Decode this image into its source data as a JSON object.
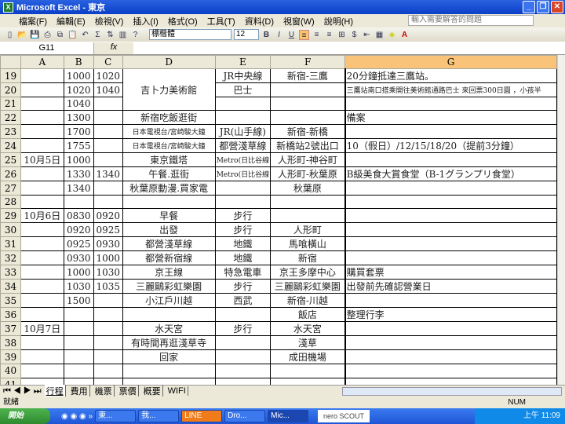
{
  "window": {
    "title": "Microsoft Excel - 東京"
  },
  "menu": [
    "檔案(F)",
    "編輯(E)",
    "檢視(V)",
    "插入(I)",
    "格式(O)",
    "工具(T)",
    "資料(D)",
    "視窗(W)",
    "說明(H)"
  ],
  "help_placeholder": "輸入需要解答的問題",
  "toolbar": {
    "font": "標楷體",
    "size": "12",
    "bold": "B",
    "italic": "I",
    "underline": "U",
    "currency": "$",
    "sum": "Σ"
  },
  "formula": {
    "cell": "G11",
    "fx": "fx",
    "value": ""
  },
  "columns": [
    "A",
    "B",
    "C",
    "D",
    "E",
    "F",
    "G"
  ],
  "rows": [
    {
      "n": "19",
      "c": [
        "",
        "1000",
        "1020",
        {
          "v": "吉卜力美術館",
          "rs": 3
        },
        "JR中央線",
        "新宿-三鷹",
        "20分鐘抵達三鷹站。"
      ]
    },
    {
      "n": "20",
      "c": [
        "",
        "1020",
        "1040",
        "巴士",
        "",
        "三鷹站南口搭乘開往美術館通路巴士 來回票300日圓 ，小孩半"
      ]
    },
    {
      "n": "21",
      "c": [
        "",
        "1040",
        "",
        "",
        "",
        ""
      ]
    },
    {
      "n": "22",
      "c": [
        "",
        "1300",
        "",
        "新宿吃飯逛街",
        "",
        "",
        "備案"
      ]
    },
    {
      "n": "23",
      "c": [
        "",
        "1700",
        "",
        "日本電視台/宮崎駿大鐘",
        "JR(山手線)",
        "新宿-新橋",
        ""
      ]
    },
    {
      "n": "24",
      "c": [
        "",
        "1755",
        "",
        "日本電視台/宮崎駿大鐘",
        "都營淺草線",
        "新橋站2號出口",
        "10（假日）/12/15/18/20（提前3分鐘）"
      ]
    },
    {
      "n": "25",
      "c": [
        "10月5日",
        "1000",
        "",
        "東京鐵塔",
        "Metro(日比谷線",
        "人形町-神谷町",
        ""
      ]
    },
    {
      "n": "26",
      "c": [
        "",
        "1330",
        "1340",
        "午餐.逛街",
        "Metro(日比谷線",
        "人形町-秋葉原",
        "B級美食大賞食堂（B-1グランプリ食堂）"
      ]
    },
    {
      "n": "27",
      "c": [
        "",
        "1340",
        "",
        "秋葉原動漫.買家電",
        "",
        "秋葉原",
        ""
      ]
    },
    {
      "n": "28",
      "c": [
        "",
        "",
        "",
        "",
        "",
        "",
        ""
      ]
    },
    {
      "n": "29",
      "c": [
        "10月6日",
        "0830",
        "0920",
        "早餐",
        "步行",
        "",
        ""
      ]
    },
    {
      "n": "30",
      "c": [
        "",
        "0920",
        "0925",
        "出發",
        "步行",
        "人形町",
        ""
      ]
    },
    {
      "n": "31",
      "c": [
        "",
        "0925",
        "0930",
        "都營淺草線",
        "地鐵",
        "馬喰橫山",
        ""
      ]
    },
    {
      "n": "32",
      "c": [
        "",
        "0930",
        "1000",
        "都營新宿線",
        "地鐵",
        "新宿",
        ""
      ]
    },
    {
      "n": "33",
      "c": [
        "",
        "1000",
        "1030",
        "京王線",
        "特急電車",
        "京王多摩中心",
        "購買套票"
      ]
    },
    {
      "n": "34",
      "c": [
        "",
        "1030",
        "1035",
        "三麗鷗彩虹樂園",
        "步行",
        "三麗鷗彩虹樂園",
        "出發前先確認營業日"
      ]
    },
    {
      "n": "35",
      "c": [
        "",
        "1500",
        "",
        "小江戶川越",
        "西武",
        "新宿-川越",
        ""
      ]
    },
    {
      "n": "36",
      "c": [
        "",
        "",
        "",
        "",
        "",
        "飯店",
        "整理行李"
      ]
    },
    {
      "n": "37",
      "c": [
        "10月7日",
        "",
        "",
        "水天宮",
        "步行",
        "水天宮",
        ""
      ]
    },
    {
      "n": "38",
      "c": [
        "",
        "",
        "",
        "有時間再逛淺草寺",
        "",
        "淺草",
        ""
      ]
    },
    {
      "n": "39",
      "c": [
        "",
        "",
        "",
        "回家",
        "",
        "成田機場",
        ""
      ]
    },
    {
      "n": "40",
      "c": [
        "",
        "",
        "",
        "",
        "",
        "",
        ""
      ]
    },
    {
      "n": "41",
      "c": [
        "",
        "",
        "",
        "",
        "",
        "",
        ""
      ]
    }
  ],
  "sheet_tabs": [
    "行程",
    "費用",
    "機票",
    "票價",
    "概要",
    "WIFI"
  ],
  "status": {
    "ready": "就緒",
    "num": "NUM"
  },
  "taskbar": {
    "start": "開始",
    "tasks": [
      "東...",
      "我...",
      "LINE",
      "Dro...",
      "Mic..."
    ],
    "clock": "上午 11:09",
    "nero": "nero SCOUT"
  }
}
